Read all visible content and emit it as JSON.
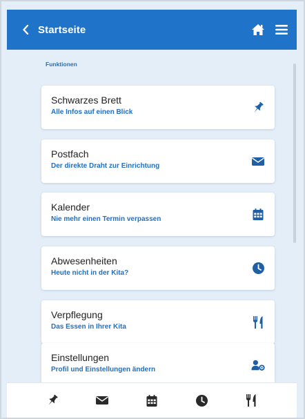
{
  "header": {
    "back_label": "Startseite",
    "icons": [
      "chevron-left-icon",
      "home-icon",
      "menu-icon"
    ]
  },
  "colors": {
    "header_bg": "#1f73c9",
    "page_bg": "#e4eef8",
    "accent": "#1f6fc4",
    "icon": "#1f5fa8"
  },
  "section": {
    "label": "Funktionen"
  },
  "cards": [
    {
      "title": "Schwarzes Brett",
      "subtitle": "Alle Infos auf einen Blick",
      "icon": "pin-icon"
    },
    {
      "title": "Postfach",
      "subtitle": "Der direkte Draht zur Einrichtung",
      "icon": "envelope-icon"
    },
    {
      "title": "Kalender",
      "subtitle": "Nie mehr einen Termin verpassen",
      "icon": "calendar-icon"
    },
    {
      "title": "Abwesenheiten",
      "subtitle": "Heute nicht in der Kita?",
      "icon": "clock-icon"
    },
    {
      "title": "Verpflegung",
      "subtitle": "Das Essen in Ihrer Kita",
      "icon": "fork-knife-icon"
    },
    {
      "title": "Einstellungen",
      "subtitle": "Profil und Einstellungen ändern",
      "icon": "user-settings-icon"
    }
  ],
  "bottom_nav": [
    "pin-icon",
    "envelope-icon",
    "calendar-icon",
    "clock-icon",
    "fork-knife-icon"
  ]
}
